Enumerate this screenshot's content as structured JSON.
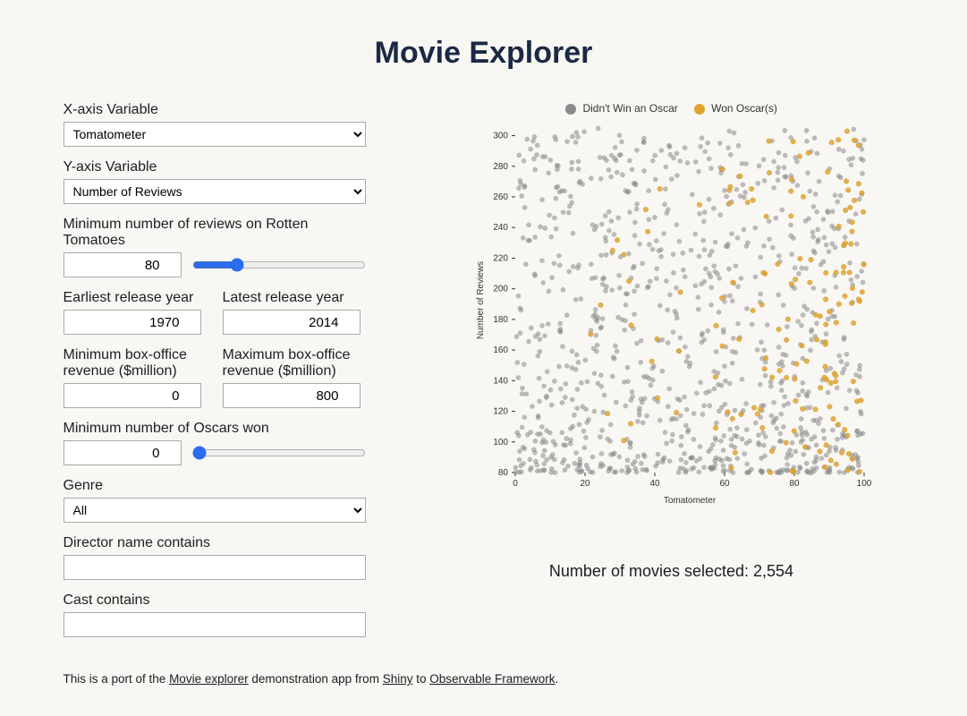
{
  "title": "Movie Explorer",
  "controls": {
    "xaxis": {
      "label": "X-axis Variable",
      "value": "Tomatometer"
    },
    "yaxis": {
      "label": "Y-axis Variable",
      "value": "Number of Reviews"
    },
    "min_reviews": {
      "label": "Minimum number of reviews on Rotten Tomatoes",
      "value": 80,
      "min": 10,
      "max": 300
    },
    "earliest_year": {
      "label": "Earliest release year",
      "value": 1970
    },
    "latest_year": {
      "label": "Latest release year",
      "value": 2014
    },
    "min_box": {
      "label": "Minimum box-office revenue ($million)",
      "value": 0
    },
    "max_box": {
      "label": "Maximum box-office revenue ($million)",
      "value": 800
    },
    "min_oscars": {
      "label": "Minimum number of Oscars won",
      "value": 0,
      "min": 0,
      "max": 4
    },
    "genre": {
      "label": "Genre",
      "value": "All"
    },
    "director": {
      "label": "Director name contains",
      "value": ""
    },
    "cast": {
      "label": "Cast contains",
      "value": ""
    }
  },
  "legend": {
    "no_oscar": {
      "label": "Didn't Win an Oscar",
      "color": "#8b8b8b"
    },
    "won_oscar": {
      "label": "Won Oscar(s)",
      "color": "#e2a52b"
    }
  },
  "status": {
    "prefix": "Number of movies selected: ",
    "count": "2,554"
  },
  "footnote": {
    "intro": "This is a port of the ",
    "link1": "Movie explorer",
    "middle": " demonstration app from ",
    "link2": "Shiny",
    "middle2": " to ",
    "link3": "Observable Framework",
    "end": "."
  },
  "chart_data": {
    "type": "scatter",
    "xlabel": "Tomatometer",
    "ylabel": "Number of Reviews",
    "xlim": [
      0,
      100
    ],
    "ylim": [
      80,
      305
    ],
    "xticks": [
      0,
      20,
      40,
      60,
      80,
      100
    ],
    "yticks": [
      80,
      100,
      120,
      140,
      160,
      180,
      200,
      220,
      240,
      260,
      280,
      300
    ],
    "series": [
      {
        "name": "Didn't Win an Oscar",
        "color": "#8b8b8b",
        "n_points": 2300,
        "note": "dense cloud, concentrated toward lower y and spread across all x"
      },
      {
        "name": "Won Oscar(s)",
        "color": "#e2a52b",
        "n_points": 254,
        "note": "scattered, skewed toward high x (70–100) and all y"
      }
    ]
  }
}
